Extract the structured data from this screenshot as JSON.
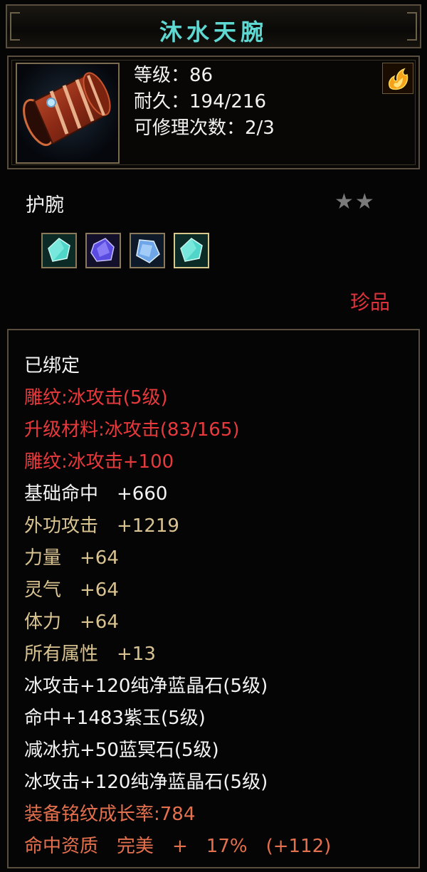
{
  "item": {
    "name": "沐水天腕",
    "level": "等级：86",
    "durability": "耐久：194/216",
    "repairs": "可修理次数：2/3",
    "type": "护腕",
    "stars": "★★",
    "star_count": 2,
    "rarity": "珍品",
    "icon": "bracer-icon",
    "badge_icon": "flame-icon"
  },
  "gems": [
    {
      "icon": "cyan-gem-icon",
      "color": "#4fd6c8"
    },
    {
      "icon": "purple-gem-icon",
      "color": "#7a6cf0"
    },
    {
      "icon": "blue-gem-icon",
      "color": "#6fa6e8"
    },
    {
      "icon": "cyan-gem-icon",
      "color": "#4fd6c8"
    }
  ],
  "attributes": [
    {
      "text": "已绑定",
      "color": "white"
    },
    {
      "text": "雕纹:冰攻击(5级)",
      "color": "red"
    },
    {
      "text": "升级材料:冰攻击(83/165)",
      "color": "red"
    },
    {
      "text": "雕纹:冰攻击+100",
      "color": "red"
    },
    {
      "text": "基础命中　+660",
      "color": "white"
    },
    {
      "text": "外功攻击　+1219",
      "color": "gold"
    },
    {
      "text": "力量　+64",
      "color": "gold"
    },
    {
      "text": "灵气　+64",
      "color": "gold"
    },
    {
      "text": "体力　+64",
      "color": "gold"
    },
    {
      "text": "所有属性　+13",
      "color": "gold"
    },
    {
      "text": "冰攻击+120纯净蓝晶石(5级)",
      "color": "white"
    },
    {
      "text": "命中+1483紫玉(5级)",
      "color": "white"
    },
    {
      "text": "减冰抗+50蓝冥石(5级)",
      "color": "white"
    },
    {
      "text": "冰攻击+120纯净蓝晶石(5级)",
      "color": "white"
    },
    {
      "text": "装备铭纹成长率:784",
      "color": "orange"
    },
    {
      "text": "命中资质　完美　+　17%　(+112)",
      "color": "orange"
    }
  ],
  "colors": {
    "title": "#5fd8d2",
    "red": "#e8393c",
    "gold": "#d9c391",
    "orange": "#e4704e",
    "border": "#5a4f3e"
  }
}
